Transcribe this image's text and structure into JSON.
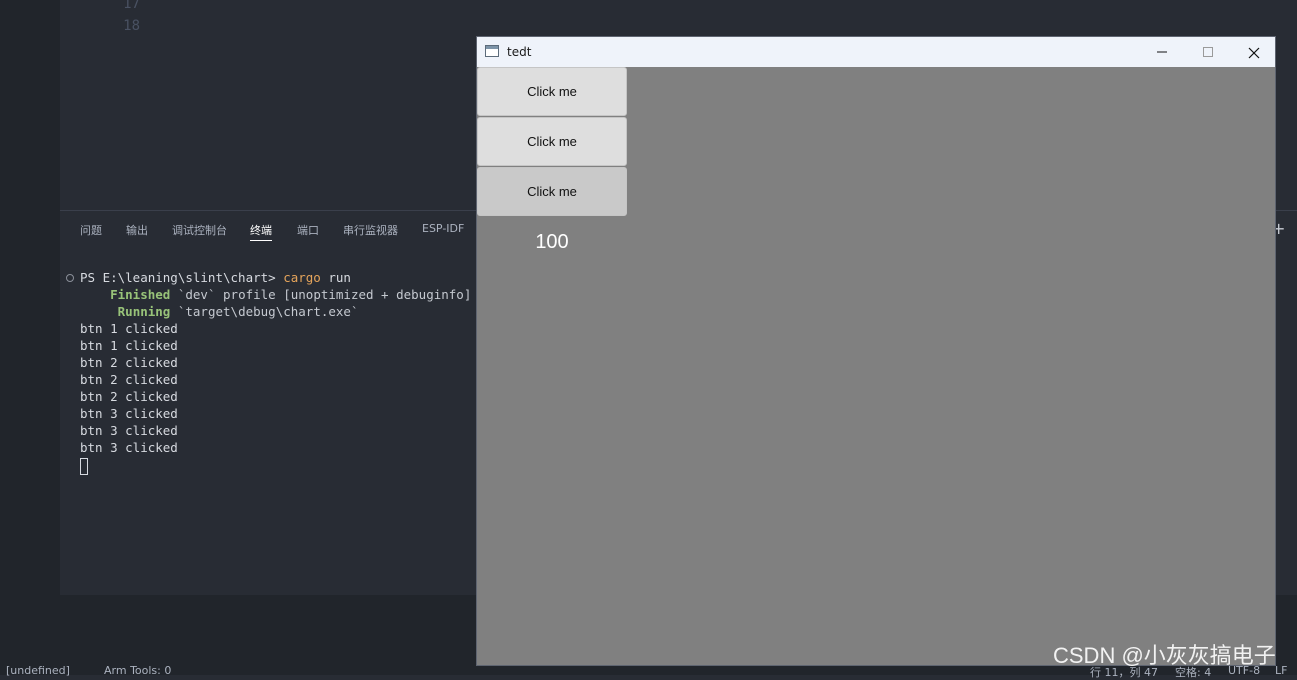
{
  "editor": {
    "line_numbers": [
      "17",
      "18"
    ]
  },
  "panel": {
    "tabs": [
      {
        "label": "问题"
      },
      {
        "label": "输出"
      },
      {
        "label": "调试控制台"
      },
      {
        "label": "终端",
        "active": true
      },
      {
        "label": "端口"
      },
      {
        "label": "串行监视器"
      },
      {
        "label": "ESP-IDF"
      }
    ],
    "add_glyph": "+"
  },
  "terminal": {
    "prompt": "PS E:\\leaning\\slint\\chart>",
    "command": "cargo",
    "command_arg": "run",
    "finished_label": "Finished",
    "finished_text": "`dev` profile [unoptimized + debuginfo] targ",
    "running_label": "Running",
    "running_text": "`target\\debug\\chart.exe`",
    "output_lines": [
      "btn 1 clicked",
      "btn 1 clicked",
      "btn 2 clicked",
      "btn 2 clicked",
      "btn 2 clicked",
      "btn 3 clicked",
      "btn 3 clicked",
      "btn 3 clicked"
    ]
  },
  "statusbar": {
    "left_1": "[undefined]",
    "left_2": "Arm Tools: 0",
    "right_1": "行 11，列 47",
    "right_2": "空格: 4",
    "right_3": "UTF-8",
    "right_4": "LF"
  },
  "app_window": {
    "title": "tedt",
    "buttons": [
      {
        "label": "Click me"
      },
      {
        "label": "Click me"
      },
      {
        "label": "Click me"
      }
    ],
    "counter": "100"
  },
  "watermark": "CSDN @小灰灰搞电子",
  "colors": {
    "editor_bg": "#282c34",
    "app_bg": "#808080",
    "command": "#e5a45b",
    "cargo_status": "#98c379"
  }
}
